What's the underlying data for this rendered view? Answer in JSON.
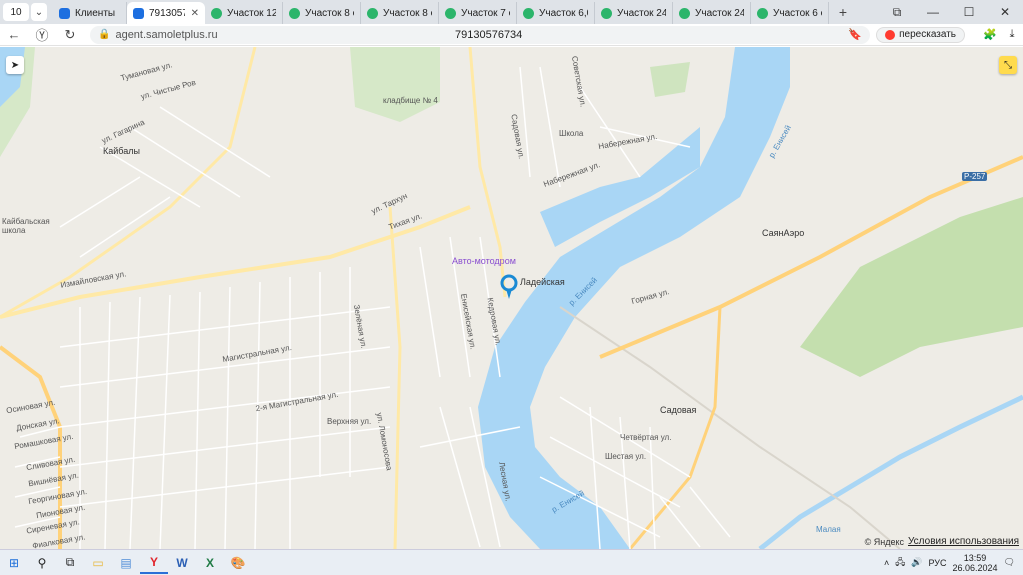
{
  "browser": {
    "tab_count": "10",
    "tabs": [
      {
        "label": "Клиенты",
        "icon": "blue",
        "active": false
      },
      {
        "label": "79130576",
        "icon": "blue",
        "active": true
      },
      {
        "label": "Участок 12 со",
        "icon": "green",
        "active": false
      },
      {
        "label": "Участок 8 со",
        "icon": "green",
        "active": false
      },
      {
        "label": "Участок 8 со",
        "icon": "green",
        "active": false
      },
      {
        "label": "Участок 7 со",
        "icon": "green",
        "active": false
      },
      {
        "label": "Участок 6,04",
        "icon": "green",
        "active": false
      },
      {
        "label": "Участок 24 с",
        "icon": "green",
        "active": false
      },
      {
        "label": "Участок 24 с",
        "icon": "green",
        "active": false
      },
      {
        "label": "Участок 6 со",
        "icon": "green",
        "active": false
      }
    ],
    "url": "agent.samoletplus.ru",
    "page_title": "79130576734",
    "retell_label": "пересказать"
  },
  "map": {
    "labels": {
      "kaibaly": "Кайбалы",
      "cemetery": "кладбище № 4",
      "school": "Школа",
      "kaibal_school": "Кайбальская школа",
      "motodrom": "Авто-мотодром",
      "station1": "Ладейская",
      "station2": "Садовая",
      "sayanaero": "СаянАэро",
      "road": "Р-257",
      "river1": "р. Енисей",
      "river2": "р. Енисей",
      "river3": "р. Енисей",
      "river4": "Малая",
      "izmail": "Измайловская ул.",
      "naberezh1": "Набережная ул.",
      "naberezh2": "Набережная ул.",
      "tikhaya": "Тихая ул.",
      "tarkhu": "ул. Тархун",
      "magistr": "Магистральная ул.",
      "magistr2": "2-я Магистральная ул.",
      "verkhnyaya": "Верхняя ул.",
      "gornaya": "Горная ул.",
      "chetvertaya": "Четвёртая ул.",
      "shestaya": "Шестая ул.",
      "sadovaya": "Садовая ул.",
      "sovetskaya": "Советская ул.",
      "gagarina": "ул. Гагарина",
      "lomonosova": "ул. Ломоносова",
      "eniseyskaya": "Енисейская ул.",
      "kedrovaya": "Кедровая ул.",
      "lesnaya": "Лесная ул.",
      "zelenaya": "Зелёная ул.",
      "osinovaya": "Осиновая ул.",
      "donskaya": "Донская ул.",
      "romashkovaya": "Ромашковая ул.",
      "slivovaya": "Сливовая ул.",
      "vishnevaya": "Вишнёвая ул.",
      "georginovaya": "Георгиновая ул.",
      "pionovaya": "Пионовая ул.",
      "sirenevaya": "Сиреневая ул.",
      "fialkovaya": "Фиалковая ул.",
      "dorozhnaya": "ул. Дорожная",
      "tuhachevsk": "Тумановая ул.",
      "chistiy": "ул. Чистые Ров"
    },
    "copyright": "© Яндекс",
    "terms": "Условия использования"
  },
  "taskbar": {
    "lang": "РУС",
    "time": "13:59",
    "date": "26.06.2024"
  }
}
